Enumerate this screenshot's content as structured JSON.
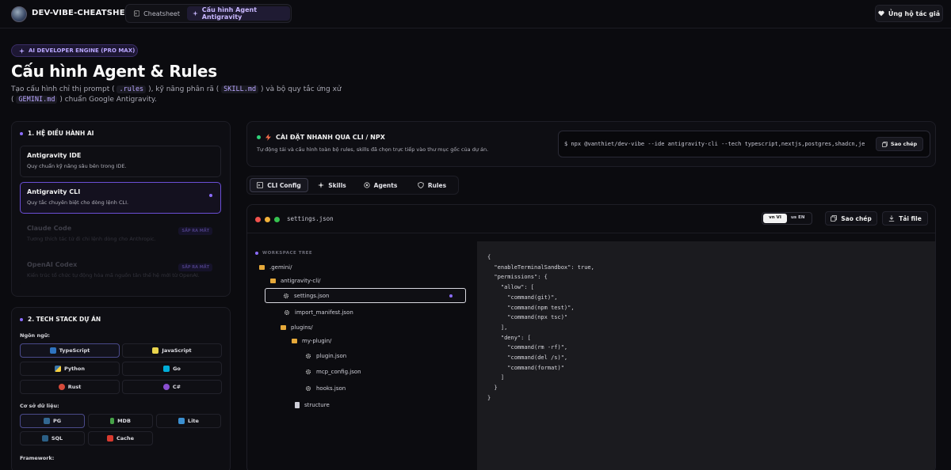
{
  "topbar": {
    "brand": "DEV-VIBE-CHEATSHEET",
    "tabs": [
      {
        "label": "Cheatsheet",
        "icon": "terminal-icon"
      },
      {
        "label": "Cấu hình Agent Antigravity",
        "icon": "sparkle-icon"
      }
    ],
    "support_label": "Ủng hộ tác giả"
  },
  "hero": {
    "badge": "AI DEVELOPER ENGINE (PRO MAX)",
    "title": "Cấu hình Agent & Rules",
    "subtitle_parts": [
      "Tạo cấu hình chỉ thị prompt (",
      ".rules",
      "), kỹ năng phân rã (",
      "SKILL.md",
      ") và bộ quy tắc ứng xử (",
      "GEMINI.md",
      ") chuẩn Google Antigravity."
    ]
  },
  "os_panel": {
    "title": "1. HỆ ĐIỀU HÀNH AI",
    "items": [
      {
        "name": "Antigravity IDE",
        "desc": "Quy chuẩn kỹ năng sâu bên trong IDE."
      },
      {
        "name": "Antigravity CLI",
        "desc": "Quy tắc chuyên biệt cho dòng lệnh CLI."
      },
      {
        "name": "Claude Code",
        "desc": "Tương thích tác tử đi chi lệnh dòng cho Anthropic.",
        "badge": "SẮP RA MẮT"
      },
      {
        "name": "OpenAI Codex",
        "desc": "Kiến trúc tổ chức tự động hóa mã nguồn tân thế hệ mới từ OpenAI.",
        "badge": "SẮP RA MẮT"
      }
    ]
  },
  "stack_panel": {
    "title": "2. TECH STACK DỰ ÁN",
    "lang_label": "Ngôn ngữ:",
    "languages": [
      "TypeScript",
      "JavaScript",
      "Python",
      "Go",
      "Rust",
      "C#"
    ],
    "db_label": "Cơ sở dữ liệu:",
    "databases": [
      "PG",
      "MDB",
      "Lite",
      "SQL",
      "Cache"
    ],
    "framework_label": "Framework:"
  },
  "cli": {
    "title": "CÀI ĐẶT NHANH QUA CLI / NPX",
    "desc": "Tự động tải và cấu hình toàn bộ rules, skills đã chọn trực tiếp vào thư mục gốc của dự án.",
    "command": "$ npx @vanthiet/dev-vibe --ide antigravity-cli --tech typescript,nextjs,postgres,shadcn,je",
    "copy_label": "Sao chép"
  },
  "tabs": [
    {
      "label": "CLI Config",
      "icon": "terminal-icon"
    },
    {
      "label": "Skills",
      "icon": "sparkle-icon"
    },
    {
      "label": "Agents",
      "icon": "bot-icon"
    },
    {
      "label": "Rules",
      "icon": "shield-icon"
    }
  ],
  "editor": {
    "filename": "settings.json",
    "lang_vi": "vn VI",
    "lang_en": "us EN",
    "copy_label": "Sao chép",
    "download_label": "Tải file",
    "tree_title": "WORKSPACE TREE",
    "tree": [
      {
        "label": ".gemini/",
        "type": "folder"
      },
      {
        "label": "antigravity-cli/",
        "type": "folder"
      },
      {
        "label": "settings.json",
        "type": "gear"
      },
      {
        "label": "import_manifest.json",
        "type": "gear"
      },
      {
        "label": "plugins/",
        "type": "folder"
      },
      {
        "label": "my-plugin/",
        "type": "folder"
      },
      {
        "label": "plugin.json",
        "type": "gear"
      },
      {
        "label": "mcp_config.json",
        "type": "gear"
      },
      {
        "label": "hooks.json",
        "type": "gear"
      },
      {
        "label": "structure",
        "type": "file"
      }
    ],
    "code": "{\n  \"enableTerminalSandbox\": true,\n  \"permissions\": {\n    \"allow\": [\n      \"command(git)\",\n      \"command(npm test)\",\n      \"command(npx tsc)\"\n    ],\n    \"deny\": [\n      \"command(rm -rf)\",\n      \"command(del /s)\",\n      \"command(format)\"\n    ]\n  }\n}"
  },
  "colors": {
    "accent": "#8b6cff",
    "background": "#0b0b0f",
    "success": "#2fd27a"
  }
}
